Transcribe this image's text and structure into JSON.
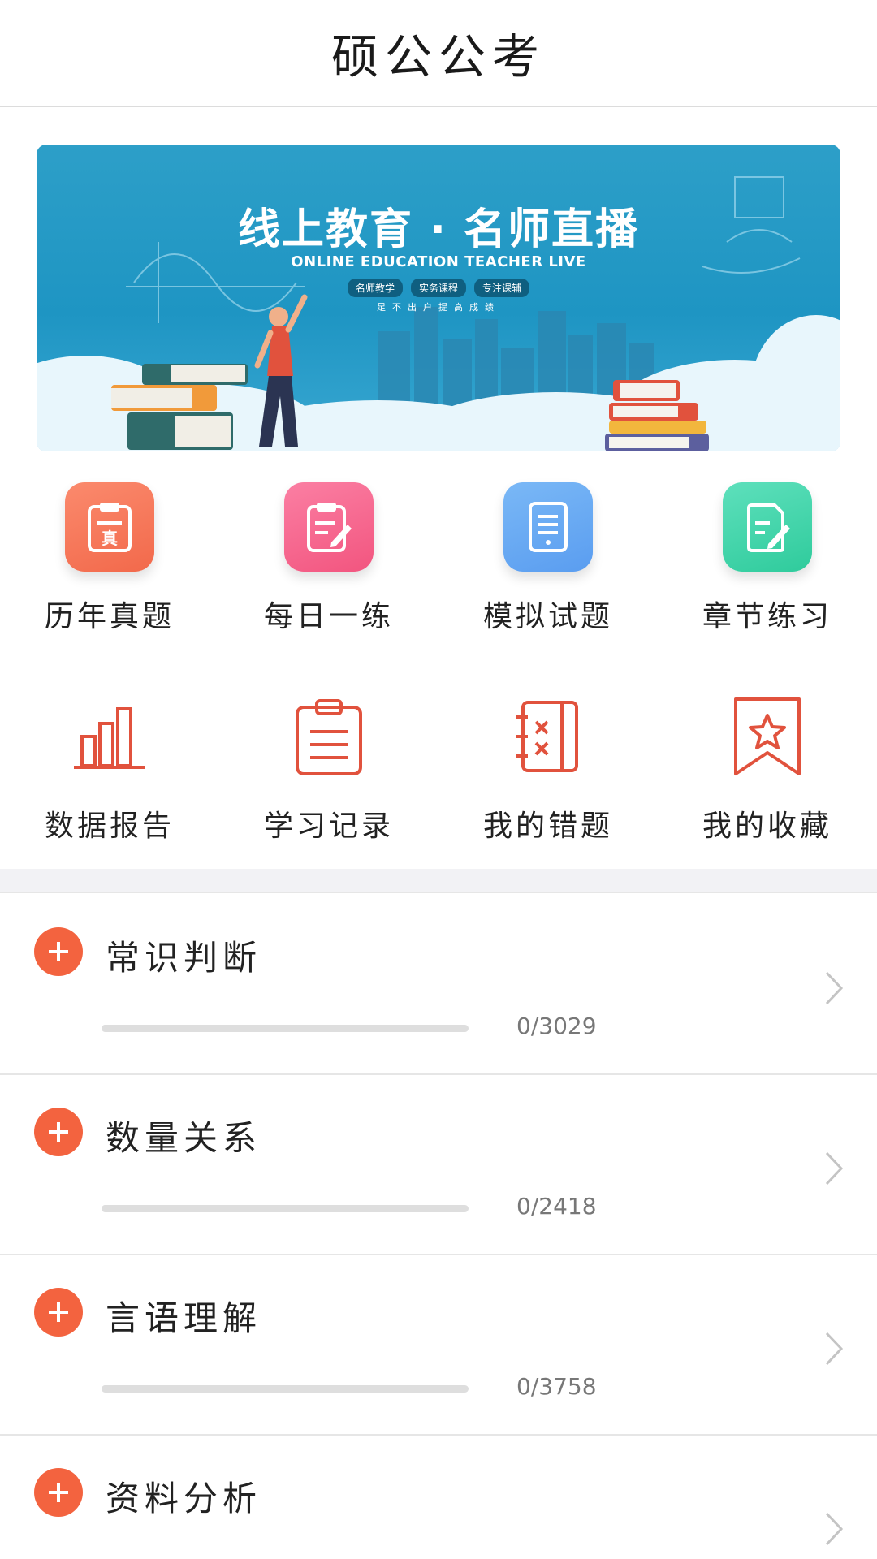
{
  "header": {
    "title": "硕公公考"
  },
  "banner": {
    "headline": "线上教育 · 名师直播",
    "subtitle": "ONLINE EDUCATION TEACHER LIVE",
    "tags": [
      "名师教学",
      "实务课程",
      "专注课辅"
    ],
    "slogan": "足不出户提高成绩"
  },
  "grid_top": [
    {
      "label": "历年真题",
      "icon": "exam-paper-icon",
      "color": "#f2694b"
    },
    {
      "label": "每日一练",
      "icon": "daily-practice-icon",
      "color": "#f2557f"
    },
    {
      "label": "模拟试题",
      "icon": "mock-test-icon",
      "color": "#5a9df0"
    },
    {
      "label": "章节练习",
      "icon": "chapter-practice-icon",
      "color": "#2fcb9c"
    }
  ],
  "grid_bottom": [
    {
      "label": "数据报告",
      "icon": "bar-chart-icon"
    },
    {
      "label": "学习记录",
      "icon": "clipboard-icon"
    },
    {
      "label": "我的错题",
      "icon": "notebook-x-icon"
    },
    {
      "label": "我的收藏",
      "icon": "bookmark-star-icon"
    }
  ],
  "accent_color": "#f3633f",
  "categories": [
    {
      "name": "常识判断",
      "count": "0/3029",
      "progress": 0
    },
    {
      "name": "数量关系",
      "count": "0/2418",
      "progress": 0
    },
    {
      "name": "言语理解",
      "count": "0/3758",
      "progress": 0
    },
    {
      "name": "资料分析",
      "count": "",
      "progress": 0
    }
  ]
}
